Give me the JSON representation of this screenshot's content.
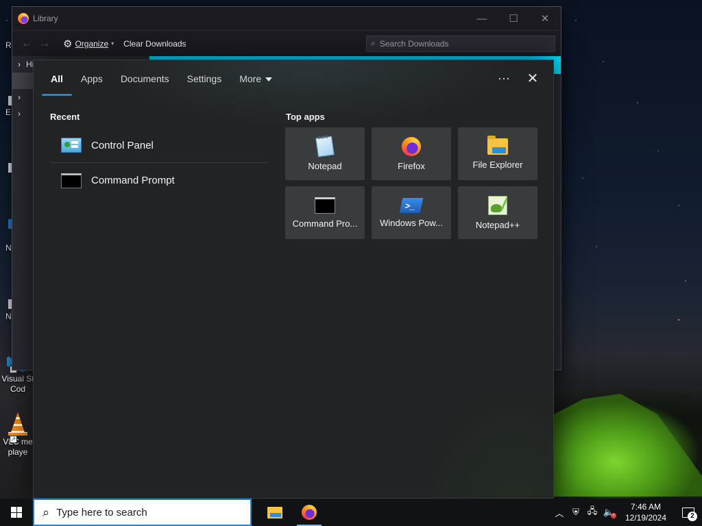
{
  "desktop": {
    "icons": [
      {
        "label_1": "Visual St",
        "label_2": "Cod",
        "icon": "vscode-icon"
      },
      {
        "label_1": "VLC me",
        "label_2": "playe",
        "icon": "vlc-icon"
      }
    ],
    "edge_letters": [
      "R",
      "E",
      "N",
      "N"
    ]
  },
  "library_window": {
    "title": "Library",
    "organize_label": "Organize",
    "clear_downloads_label": "Clear Downloads",
    "search_placeholder": "Search Downloads",
    "tree_history": "History"
  },
  "flyout": {
    "tabs": [
      {
        "label": "All",
        "active": true
      },
      {
        "label": "Apps"
      },
      {
        "label": "Documents"
      },
      {
        "label": "Settings"
      },
      {
        "label": "More"
      }
    ],
    "more_icon": "ellipsis-icon",
    "close_icon": "close-icon",
    "recent_title": "Recent",
    "recent": [
      {
        "label": "Control Panel",
        "icon": "control-panel-icon"
      },
      {
        "label": "Command Prompt",
        "icon": "command-prompt-icon"
      }
    ],
    "top_apps_title": "Top apps",
    "top_apps": [
      {
        "label": "Notepad",
        "icon": "notepad-icon"
      },
      {
        "label": "Firefox",
        "icon": "firefox-icon"
      },
      {
        "label": "File Explorer",
        "icon": "file-explorer-icon"
      },
      {
        "label": "Command Pro...",
        "icon": "command-prompt-icon"
      },
      {
        "label": "Windows Pow...",
        "icon": "powershell-icon"
      },
      {
        "label": "Notepad++",
        "icon": "notepad-plus-plus-icon"
      }
    ]
  },
  "taskbar": {
    "search_placeholder": "Type here to search",
    "pinned": [
      {
        "name": "file-explorer",
        "icon": "folder-icon"
      },
      {
        "name": "firefox",
        "icon": "firefox-icon",
        "running": true
      }
    ],
    "clock_time": "7:46 AM",
    "clock_date": "12/19/2024",
    "notification_count": "2"
  },
  "colors": {
    "accent": "#1a8ad4",
    "flyout_bg": "#222324",
    "tile_bg": "#3a3b3d",
    "taskbar_bg": "#101214",
    "library_strip": "#00ddff"
  }
}
